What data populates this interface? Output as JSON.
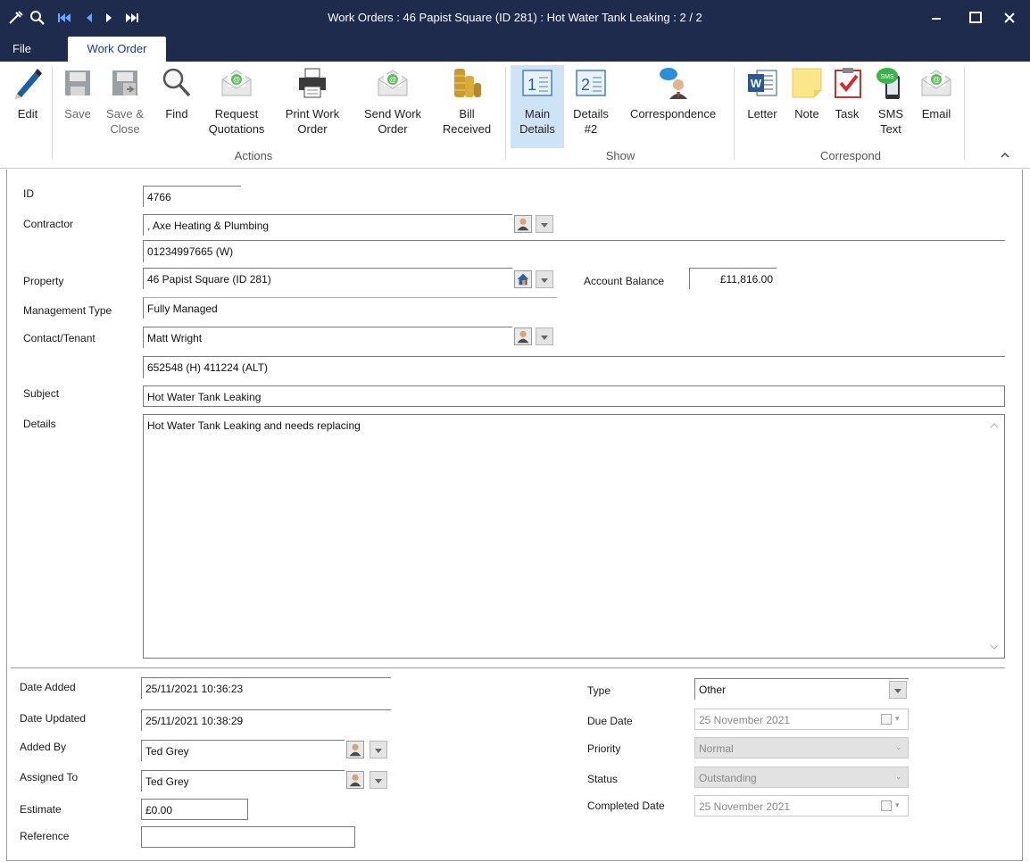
{
  "window": {
    "title": "Work Orders : 46 Papist Square (ID 281) : Hot Water Tank Leaking : 2 / 2"
  },
  "tabs": {
    "file": "File",
    "work_order": "Work Order"
  },
  "ribbon": {
    "actions": {
      "label": "Actions",
      "edit": "Edit",
      "save": "Save",
      "save_close_1": "Save &",
      "save_close_2": "Close",
      "find": "Find",
      "request_q_1": "Request",
      "request_q_2": "Quotations",
      "print_1": "Print Work",
      "print_2": "Order",
      "send_1": "Send Work",
      "send_2": "Order",
      "bill_1": "Bill",
      "bill_2": "Received"
    },
    "show": {
      "label": "Show",
      "main_1": "Main",
      "main_2": "Details",
      "details2_1": "Details",
      "details2_2": "#2",
      "correspondence": "Correspondence"
    },
    "correspond": {
      "label": "Correspond",
      "letter": "Letter",
      "note": "Note",
      "task": "Task",
      "sms_1": "SMS",
      "sms_2": "Text",
      "email": "Email"
    }
  },
  "form": {
    "id_label": "ID",
    "id_value": "4766",
    "contractor_label": "Contractor",
    "contractor_value": ", Axe Heating & Plumbing",
    "contractor_phone": "01234997665 (W)",
    "property_label": "Property",
    "property_value": "46 Papist Square (ID 281)",
    "account_balance_label": "Account Balance",
    "account_balance_value": "£11,816.00",
    "management_type_label": "Management Type",
    "management_type_value": "Fully Managed",
    "contact_label": "Contact/Tenant",
    "contact_value": "Matt Wright",
    "contact_phone": "652548 (H) 411224 (ALT)",
    "subject_label": "Subject",
    "subject_value": "Hot Water Tank Leaking",
    "details_label": "Details",
    "details_value": "Hot Water Tank Leaking and needs replacing",
    "date_added_label": "Date Added",
    "date_added_value": "25/11/2021 10:36:23",
    "date_updated_label": "Date Updated",
    "date_updated_value": "25/11/2021 10:38:29",
    "added_by_label": "Added By",
    "added_by_value": "Ted Grey",
    "assigned_to_label": "Assigned To",
    "assigned_to_value": "Ted Grey",
    "estimate_label": "Estimate",
    "estimate_value": "£0.00",
    "reference_label": "Reference",
    "reference_value": "",
    "type_label": "Type",
    "type_value": "Other",
    "due_date_label": "Due Date",
    "due_date_value": "25 November 2021",
    "priority_label": "Priority",
    "priority_value": "Normal",
    "status_label": "Status",
    "status_value": "Outstanding",
    "completed_date_label": "Completed Date",
    "completed_date_value": "25 November 2021"
  }
}
